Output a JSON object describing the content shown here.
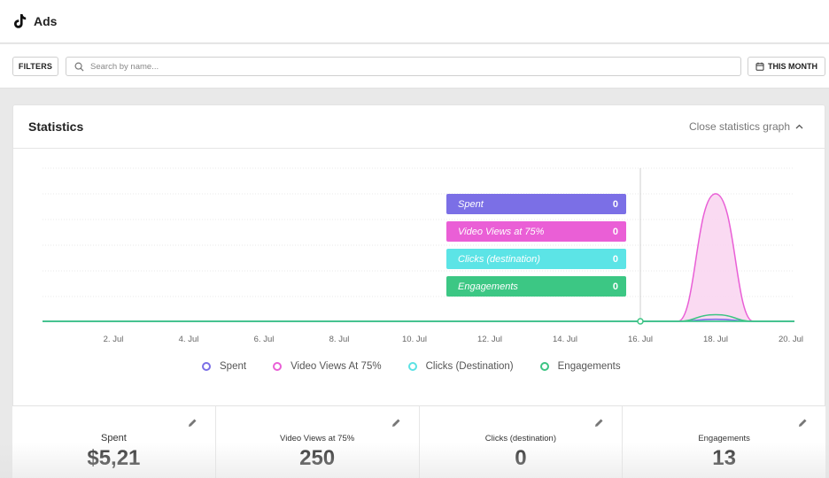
{
  "app": {
    "title": "Ads",
    "logo_icon": "tiktok-logo-icon"
  },
  "filterbar": {
    "filters_label": "FILTERS",
    "search_placeholder": "Search by name...",
    "search_value": "",
    "period_label": "THIS MONTH"
  },
  "statistics": {
    "title": "Statistics",
    "close_label": "Close statistics graph"
  },
  "colors": {
    "spent": "#7b6fe6",
    "video_views": "#e95fd6",
    "clicks": "#5ce2e4",
    "engagements": "#3cc483"
  },
  "tooltip": [
    {
      "label": "Spent",
      "value": "0",
      "color": "#7b6fe6"
    },
    {
      "label": "Video Views at 75%",
      "value": "0",
      "color": "#ea5fd6"
    },
    {
      "label": "Clicks (destination)",
      "value": "0",
      "color": "#5ce4e6"
    },
    {
      "label": "Engagements",
      "value": "0",
      "color": "#3cc784"
    }
  ],
  "legend": [
    {
      "label": "Spent",
      "color": "#7b6fe6"
    },
    {
      "label": "Video Views At 75%",
      "color": "#e95fd6"
    },
    {
      "label": "Clicks (Destination)",
      "color": "#5ce2e4"
    },
    {
      "label": "Engagements",
      "color": "#3cc483"
    }
  ],
  "chart_data": {
    "type": "area",
    "x_ticks": [
      "2. Jul",
      "4. Jul",
      "6. Jul",
      "8. Jul",
      "10. Jul",
      "12. Jul",
      "14. Jul",
      "16. Jul",
      "18. Jul",
      "20. Jul"
    ],
    "x_days": [
      0,
      1,
      2,
      3,
      4,
      5,
      6,
      7,
      8,
      9,
      10,
      11,
      12,
      13,
      14,
      15,
      16,
      17,
      18,
      19,
      20
    ],
    "hover_day": 16,
    "grid": true,
    "legend_placement": "bottom",
    "series": [
      {
        "name": "Spent",
        "values": [
          0,
          0,
          0,
          0,
          0,
          0,
          0,
          0,
          0,
          0,
          0,
          0,
          0,
          0,
          0,
          0,
          0,
          0,
          4,
          0,
          0
        ]
      },
      {
        "name": "Video Views At 75%",
        "values": [
          0,
          0,
          0,
          0,
          0,
          0,
          0,
          0,
          0,
          0,
          0,
          0,
          0,
          0,
          0,
          0,
          0,
          0,
          250,
          0,
          0
        ]
      },
      {
        "name": "Clicks (Destination)",
        "values": [
          0,
          0,
          0,
          0,
          0,
          0,
          0,
          0,
          0,
          0,
          0,
          0,
          0,
          0,
          0,
          0,
          0,
          0,
          0,
          0,
          0
        ]
      },
      {
        "name": "Engagements",
        "values": [
          0,
          0,
          0,
          0,
          0,
          0,
          0,
          0,
          0,
          0,
          0,
          0,
          0,
          0,
          0,
          0,
          0,
          0,
          13,
          0,
          0
        ]
      }
    ],
    "ylim": [
      0,
      300
    ]
  },
  "tiles": [
    {
      "label": "Spent",
      "value": "$5,21"
    },
    {
      "label": "Video Views at 75%",
      "value": "250"
    },
    {
      "label": "Clicks (destination)",
      "value": "0"
    },
    {
      "label": "Engagements",
      "value": "13"
    }
  ]
}
